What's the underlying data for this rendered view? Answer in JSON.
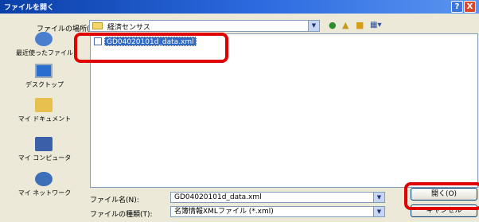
{
  "window": {
    "title": "ファイルを開く",
    "help_label": "?",
    "close_label": "X"
  },
  "lookin": {
    "label": "ファイルの場所(I):",
    "value": "経済センサス"
  },
  "places": [
    {
      "label": "最近使ったファイル",
      "icon": "recent-files-icon"
    },
    {
      "label": "デスクトップ",
      "icon": "desktop-icon"
    },
    {
      "label": "マイ ドキュメント",
      "icon": "my-documents-icon"
    },
    {
      "label": "マイ コンピュータ",
      "icon": "my-computer-icon"
    },
    {
      "label": "マイ ネットワーク",
      "icon": "my-network-icon"
    }
  ],
  "files": [
    {
      "name": "GD04020101d_data.xml"
    }
  ],
  "filename": {
    "label": "ファイル名(N):",
    "value": "GD04020101d_data.xml"
  },
  "filetype": {
    "label": "ファイルの種類(T):",
    "value": "名簿情報XMLファイル (*.xml)"
  },
  "buttons": {
    "open": "開く(O)",
    "cancel": "キャンセル"
  },
  "colors": {
    "highlight": "#e00000",
    "selection": "#316ac5",
    "titlebar": "#0a3fa8"
  }
}
